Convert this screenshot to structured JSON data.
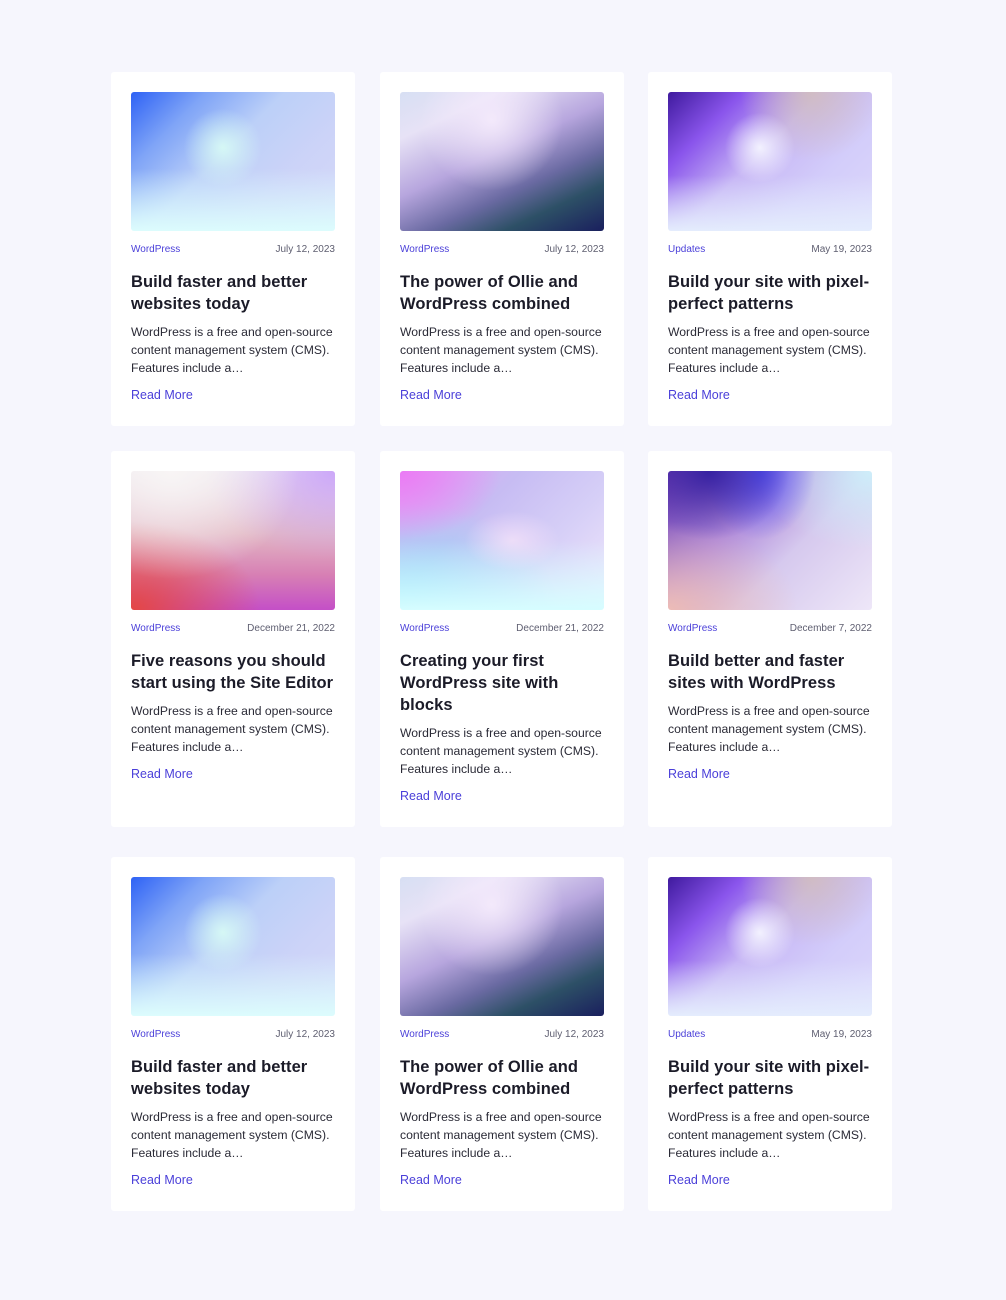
{
  "read_more_label": "Read More",
  "posts": [
    {
      "category": "WordPress",
      "date": "July 12, 2023",
      "title": "Build faster and better websites today",
      "excerpt": "WordPress is a free and open-source content management system (CMS). Features include a…",
      "thumbnail": "gradient-blue-cyan"
    },
    {
      "category": "WordPress",
      "date": "July 12, 2023",
      "title": "The power of Ollie and WordPress combined",
      "excerpt": "WordPress is a free and open-source content management system (CMS). Features include a…",
      "thumbnail": "gradient-lavender-navy"
    },
    {
      "category": "Updates",
      "date": "May 19, 2023",
      "title": "Build your site with pixel-perfect patterns",
      "excerpt": "WordPress is a free and open-source content management system (CMS). Features include a…",
      "thumbnail": "gradient-violet-white"
    },
    {
      "category": "WordPress",
      "date": "December 21, 2022",
      "title": "Five reasons you should start using the Site Editor",
      "excerpt": "WordPress is a free and open-source content management system (CMS). Features include a…",
      "thumbnail": "gradient-cream-coral-magenta"
    },
    {
      "category": "WordPress",
      "date": "December 21, 2022",
      "title": "Creating your first WordPress site with blocks",
      "excerpt": "WordPress is a free and open-source content management system (CMS). Features include a…",
      "thumbnail": "gradient-pink-aqua"
    },
    {
      "category": "WordPress",
      "date": "December 7, 2022",
      "title": "Build better and faster sites with WordPress",
      "excerpt": "WordPress is a free and open-source content management system (CMS). Features include a…",
      "thumbnail": "gradient-indigo-peach"
    },
    {
      "category": "WordPress",
      "date": "July 12, 2023",
      "title": "Build faster and better websites today",
      "excerpt": "WordPress is a free and open-source content management system (CMS). Features include a…",
      "thumbnail": "gradient-blue-cyan"
    },
    {
      "category": "WordPress",
      "date": "July 12, 2023",
      "title": "The power of Ollie and WordPress combined",
      "excerpt": "WordPress is a free and open-source content management system (CMS). Features include a…",
      "thumbnail": "gradient-lavender-navy"
    },
    {
      "category": "Updates",
      "date": "May 19, 2023",
      "title": "Build your site with pixel-perfect patterns",
      "excerpt": "WordPress is a free and open-source content management system (CMS). Features include a…",
      "thumbnail": "gradient-violet-white"
    }
  ],
  "colors": {
    "page_bg": "#f6f6fd",
    "card_bg": "#ffffff",
    "accent": "#4a3fd9",
    "text": "#1b1b28"
  }
}
